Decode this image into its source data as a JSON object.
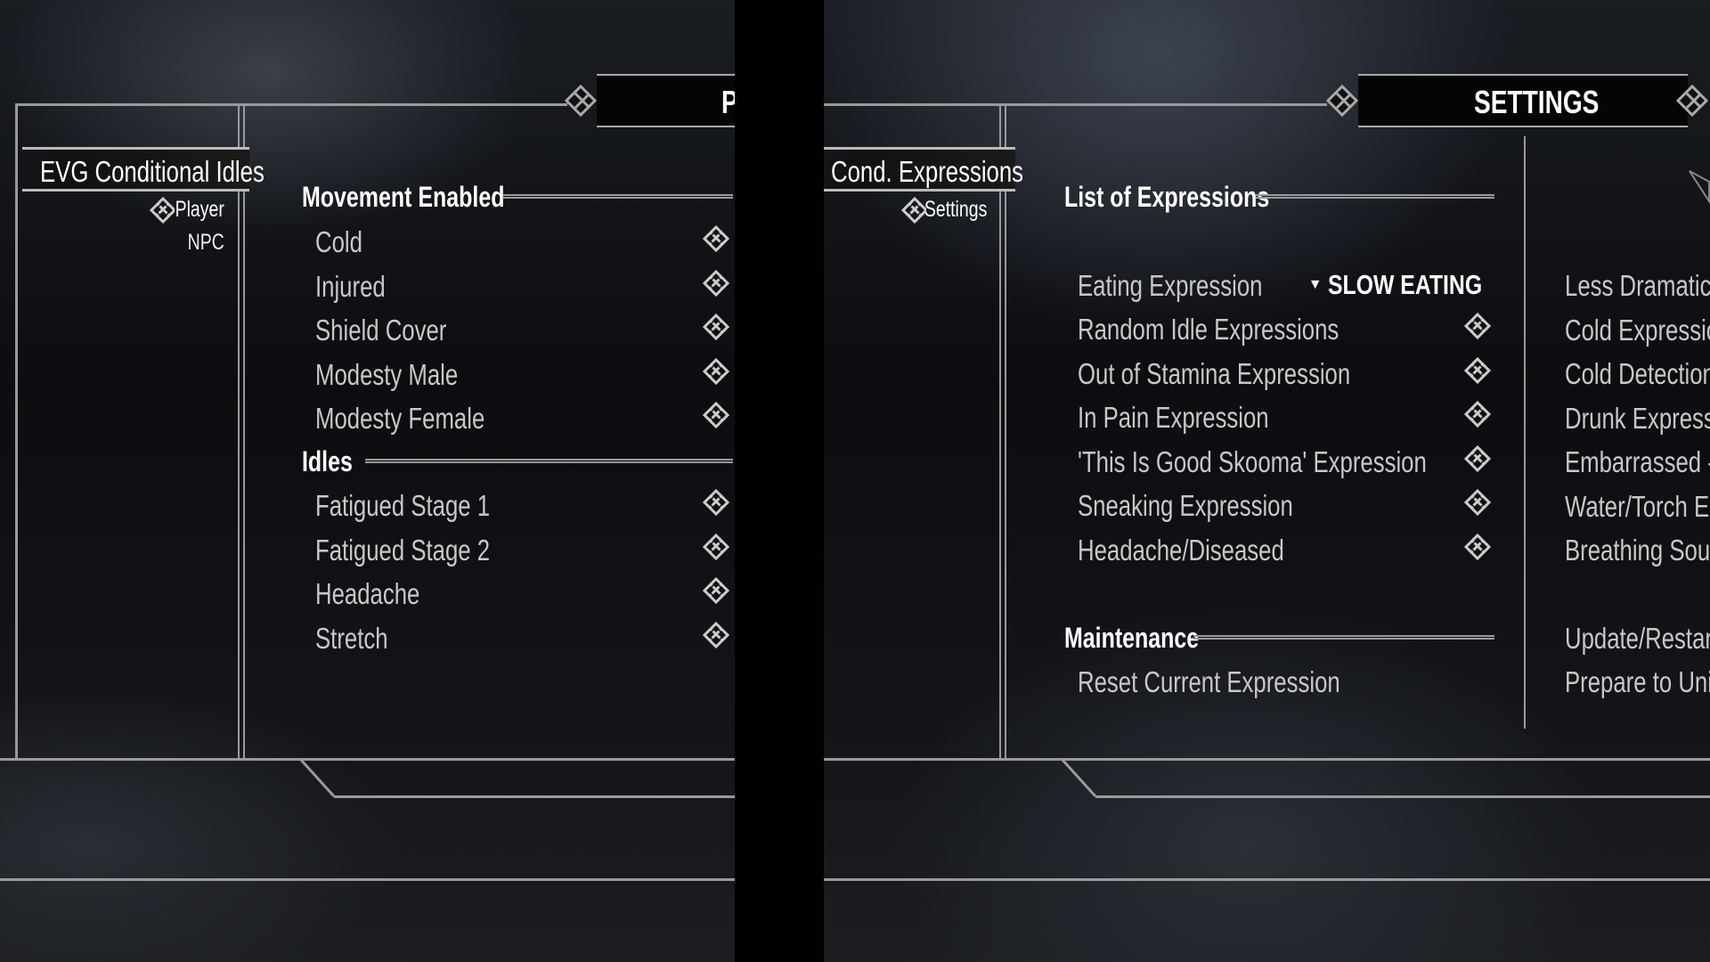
{
  "left_panel": {
    "banner_title": "P",
    "mod_tab": "EVG Conditional Idles",
    "pages": [
      {
        "label": "Player",
        "selected": true
      },
      {
        "label": "NPC",
        "selected": false
      }
    ],
    "sections": [
      {
        "header": "Movement Enabled",
        "items": [
          {
            "label": "Cold",
            "toggle": "knot-icon"
          },
          {
            "label": "Injured",
            "toggle": "knot-icon"
          },
          {
            "label": "Shield Cover",
            "toggle": "knot-icon"
          },
          {
            "label": "Modesty Male",
            "toggle": "knot-icon"
          },
          {
            "label": "Modesty Female",
            "toggle": "knot-icon"
          }
        ]
      },
      {
        "header": "Idles",
        "items": [
          {
            "label": "Fatigued Stage 1",
            "toggle": "knot-icon"
          },
          {
            "label": "Fatigued Stage 2",
            "toggle": "knot-icon"
          },
          {
            "label": "Headache",
            "toggle": "knot-icon"
          },
          {
            "label": "Stretch",
            "toggle": "knot-icon"
          }
        ]
      }
    ]
  },
  "right_panel": {
    "banner_title": "SETTINGS",
    "mod_tab": "Cond. Expressions",
    "pages": [
      {
        "label": "Settings",
        "selected": true
      }
    ],
    "list_header": "List of Expressions",
    "eating": {
      "label": "Eating Expression",
      "value": "SLOW EATING"
    },
    "items": [
      "Random Idle Expressions",
      "Out of Stamina Expression",
      "In Pain Expression",
      "'This Is Good Skooma' Expression",
      "Sneaking Expression",
      "Headache/Diseased"
    ],
    "maintenance_header": "Maintenance",
    "maintenance_items": [
      "Reset Current Expression"
    ],
    "right_column": [
      "Less Dramatic Co",
      "Cold Expression",
      "Cold Detection",
      "Drunk Expression",
      "Embarrassed - No",
      "Water/Torch Exp",
      "Breathing Sounds"
    ],
    "right_column_maint": [
      "Update/Restart",
      "Prepare to Uninst"
    ]
  }
}
